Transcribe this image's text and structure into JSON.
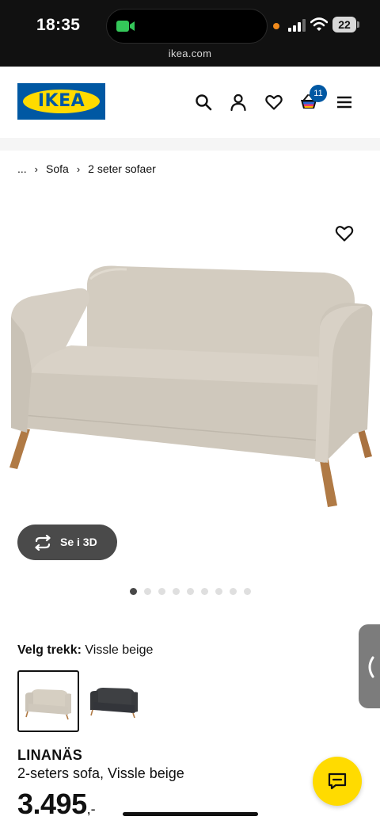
{
  "status_bar": {
    "time": "18:35",
    "battery": "22",
    "url": "ikea.com"
  },
  "header": {
    "logo_text": "IKEA",
    "cart_count": "11",
    "icons": [
      "search-icon",
      "user-icon",
      "heart-icon",
      "cart-icon",
      "menu-icon"
    ]
  },
  "breadcrumb": {
    "items": [
      "...",
      "Sofa",
      "2 seter sofaer"
    ]
  },
  "gallery": {
    "view_3d_label": "Se i 3D",
    "dot_count": 9,
    "active_dot": 0
  },
  "variant": {
    "label": "Velg trekk:",
    "value": "Vissle beige",
    "options": [
      {
        "color": "#d6cfc2",
        "selected": true
      },
      {
        "color": "#3e4043",
        "selected": false
      }
    ]
  },
  "product": {
    "name": "LINANÄS",
    "description": "2-seters sofa, Vissle beige",
    "price": "3.495",
    "price_suffix": ",-"
  },
  "colors": {
    "brand_blue": "#0058a3",
    "brand_yellow": "#ffdb00",
    "sofa_fabric": "#d6cfc2",
    "sofa_legs": "#b07a45"
  }
}
